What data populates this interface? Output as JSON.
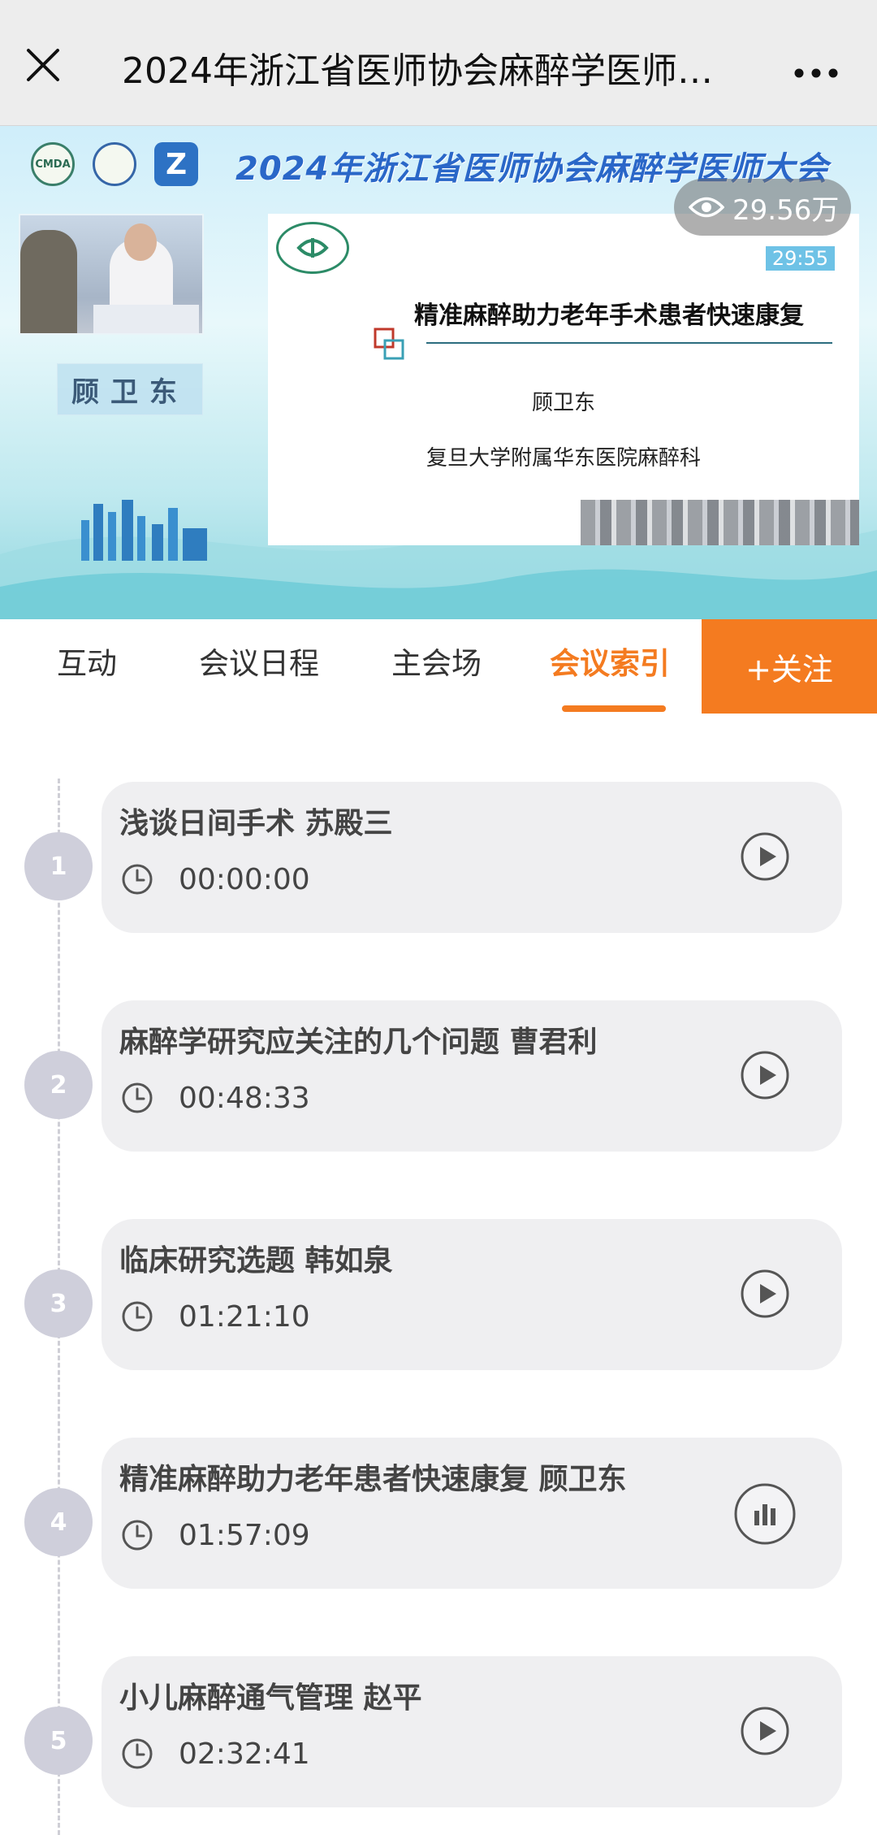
{
  "header": {
    "title": "2024年浙江省医师协会麻醉学医师…",
    "close_icon": "close-icon",
    "more_icon": "more-dots-icon"
  },
  "video": {
    "banner": "2024年浙江省医师协会麻醉学医师大会",
    "logo_labels": [
      "CMDA",
      "",
      "Z"
    ],
    "speaker_tag": "顾卫东",
    "views": "29.56万",
    "slide": {
      "timer": "29:55",
      "title": "精准麻醉助力老年手术患者快速康复",
      "speaker": "顾卫东",
      "affiliation": "复旦大学附属华东医院麻醉科"
    }
  },
  "tabs": {
    "items": [
      {
        "label": "互动"
      },
      {
        "label": "会议日程"
      },
      {
        "label": "主会场"
      },
      {
        "label": "会议索引"
      }
    ],
    "active": "会议索引",
    "follow_label": "+关注"
  },
  "index": {
    "entries": [
      {
        "number": "1",
        "title": "浅谈日间手术 苏殿三",
        "time": "00:00:00",
        "state": "play"
      },
      {
        "number": "2",
        "title": "麻醉学研究应关注的几个问题 曹君利",
        "time": "00:48:33",
        "state": "play"
      },
      {
        "number": "3",
        "title": "临床研究选题 韩如泉",
        "time": "01:21:10",
        "state": "play"
      },
      {
        "number": "4",
        "title": "精准麻醉助力老年患者快速康复 顾卫东",
        "time": "01:57:09",
        "state": "playing"
      },
      {
        "number": "5",
        "title": "小儿麻醉通气管理 赵平",
        "time": "02:32:41",
        "state": "play"
      }
    ]
  },
  "colors": {
    "accent": "#f47b20",
    "card_bg": "#efeff1",
    "badge_bg": "#cfcfdb"
  }
}
